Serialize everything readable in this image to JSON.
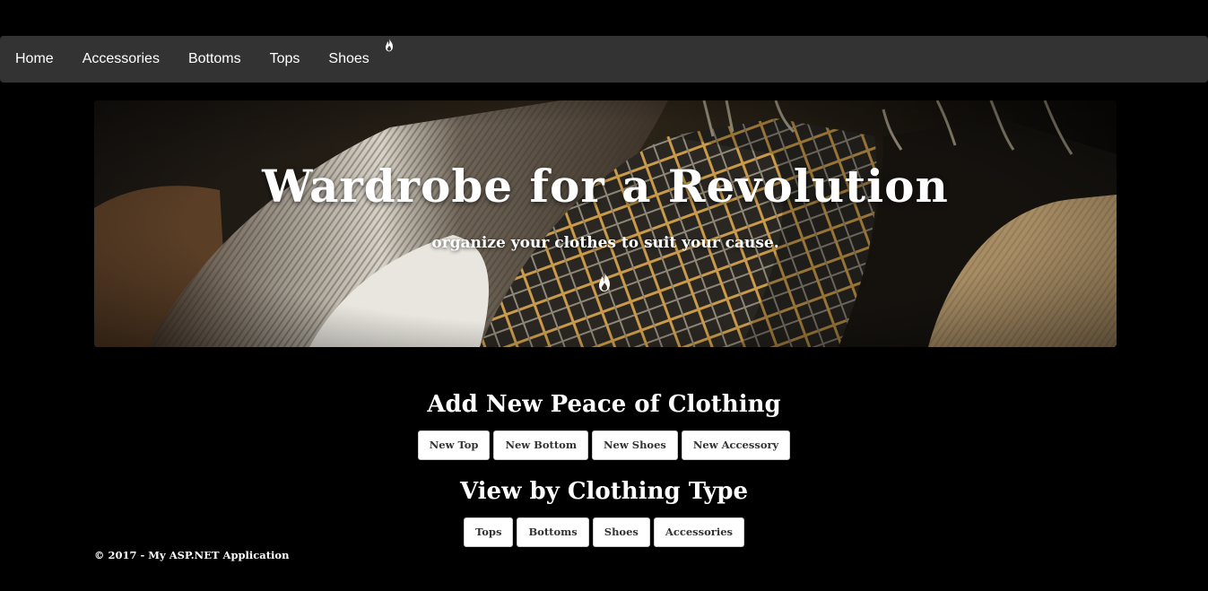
{
  "navbar": {
    "items": [
      {
        "label": "Home"
      },
      {
        "label": "Accessories"
      },
      {
        "label": "Bottoms"
      },
      {
        "label": "Tops"
      },
      {
        "label": "Shoes"
      }
    ],
    "brand_icon": "flame-icon"
  },
  "hero": {
    "title": "Wardrobe for a Revolution",
    "subtitle": "organize your clothes to suit your cause.",
    "icon": "flame-icon"
  },
  "add_section": {
    "title": "Add New Peace of Clothing",
    "buttons": [
      {
        "label": "New Top"
      },
      {
        "label": "New Bottom"
      },
      {
        "label": "New Shoes"
      },
      {
        "label": "New Accessory"
      }
    ]
  },
  "view_section": {
    "title": "View by Clothing Type",
    "buttons": [
      {
        "label": "Tops"
      },
      {
        "label": "Bottoms"
      },
      {
        "label": "Shoes"
      },
      {
        "label": "Accessories"
      }
    ]
  },
  "footer": {
    "text": "© 2017 - My ASP.NET Application"
  },
  "colors": {
    "background": "#000000",
    "navbar": "#333333",
    "text": "#ffffff",
    "button_bg": "#ffffff",
    "button_text": "#333333"
  }
}
